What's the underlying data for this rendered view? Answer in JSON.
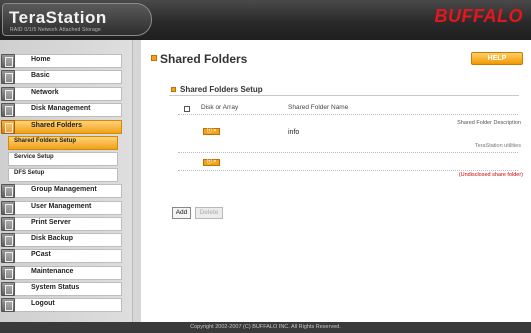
{
  "header": {
    "logo": "TeraStation",
    "logo_subtitle": "RAID 0/1/5 Network Attached Storage",
    "brand": "BUFFALO"
  },
  "sidebar": {
    "items": [
      {
        "label": "Home",
        "icon": "home-icon"
      },
      {
        "label": "Basic",
        "icon": "basic-icon"
      },
      {
        "label": "Network",
        "icon": "network-icon"
      },
      {
        "label": "Disk Management",
        "icon": "disk-icon"
      },
      {
        "label": "Shared Folders",
        "icon": "folder-icon",
        "active": true
      },
      {
        "label": "Group Management",
        "icon": "group-icon"
      },
      {
        "label": "User Management",
        "icon": "user-icon"
      },
      {
        "label": "Print Server",
        "icon": "printer-icon"
      },
      {
        "label": "Disk Backup",
        "icon": "backup-icon"
      },
      {
        "label": "PCast",
        "icon": "pcast-icon"
      },
      {
        "label": "Maintenance",
        "icon": "maintenance-icon"
      },
      {
        "label": "System Status",
        "icon": "status-icon"
      },
      {
        "label": "Logout",
        "icon": "logout-icon"
      }
    ],
    "subitems": [
      {
        "label": "Shared Folders Setup",
        "active": true
      },
      {
        "label": "Service Setup"
      },
      {
        "label": "DFS Setup"
      }
    ]
  },
  "main": {
    "title": "Shared Folders",
    "help_label": "HELP",
    "section_title": "Shared Folders Setup",
    "columns": {
      "disk": "Disk or Array",
      "name": "Shared Folder Name",
      "description": "Shared Folder Description"
    },
    "rows": [
      {
        "button": "ⓣ >",
        "name": "info",
        "description": "TeraStation utilities"
      },
      {
        "button": "ⓣ >",
        "name": "",
        "description": "(Undisclosed share folder)"
      }
    ],
    "add_label": "Add",
    "delete_label": "Delete"
  },
  "footer": {
    "copyright": "Copyright 2002-2007 (C) BUFFALO INC. All Rights Reserved."
  },
  "colors": {
    "accent": "#f0a21a",
    "brand": "#e8151c",
    "warning_text": "#d20000"
  }
}
